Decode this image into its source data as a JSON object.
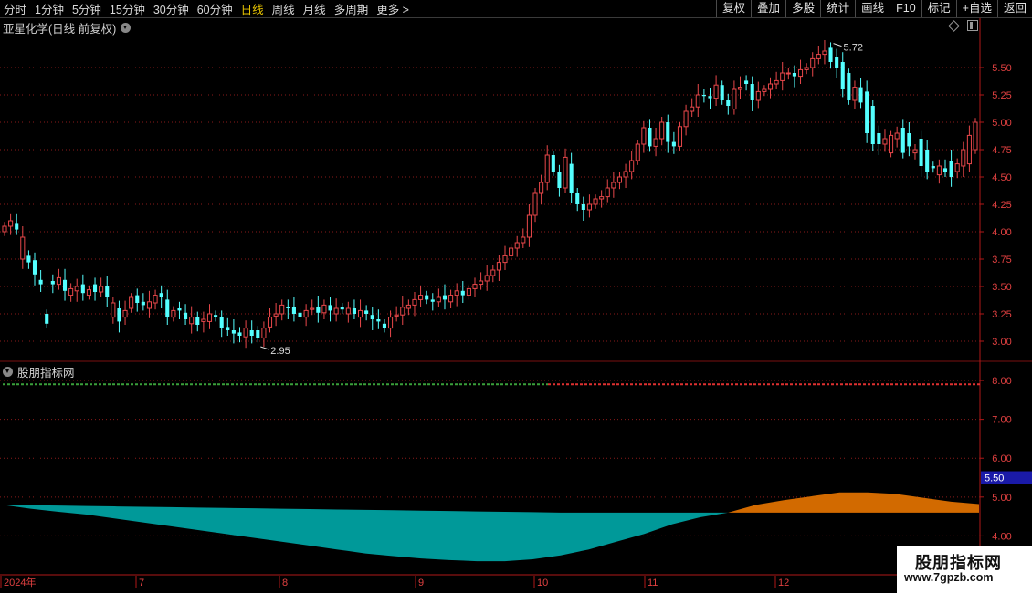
{
  "toolbar": {
    "periods": [
      "分时",
      "1分钟",
      "5分钟",
      "15分钟",
      "30分钟",
      "60分钟",
      "日线",
      "周线",
      "月线",
      "多周期",
      "更多 >"
    ],
    "active_period": "日线",
    "actions": [
      "复权",
      "叠加",
      "多股",
      "统计",
      "画线",
      "F10",
      "标记",
      "+自选",
      "返回"
    ]
  },
  "main_title": "亚星化学(日线 前复权)",
  "indicator_title": "股朋指标网",
  "watermark": {
    "line1": "股朋指标网",
    "line2": "www.7gpzb.com"
  },
  "colors": {
    "up": "#e8474a",
    "down": "#54ffff",
    "grid": "#8a1a1a",
    "axis": "#b01818",
    "teal": "#009999",
    "orange": "#d26a00"
  },
  "chart_data": [
    {
      "type": "candlestick",
      "title": "亚星化学(日线 前复权)",
      "y_ticks": [
        5.5,
        5.25,
        5.0,
        4.75,
        4.5,
        4.25,
        4.0,
        3.75,
        3.5,
        3.25,
        3.0
      ],
      "ylim": [
        2.85,
        5.8
      ],
      "annotations": [
        {
          "label": "5.72",
          "value": 5.72
        },
        {
          "label": "2.95",
          "value": 2.95
        }
      ],
      "date_labels": [
        "2024年",
        "7",
        "8",
        "9",
        "10",
        "11",
        "12"
      ],
      "closes": [
        4.05,
        4.1,
        4.02,
        3.95,
        3.72,
        3.61,
        3.52,
        3.16,
        3.52,
        3.58,
        3.46,
        3.48,
        3.5,
        3.44,
        3.47,
        3.45,
        3.5,
        3.4,
        3.35,
        3.18,
        3.28,
        3.4,
        3.35,
        3.33,
        3.36,
        3.42,
        3.4,
        3.22,
        3.28,
        3.28,
        3.2,
        3.22,
        3.15,
        3.2,
        3.25,
        3.22,
        3.12,
        3.1,
        3.07,
        3.05,
        3.12,
        3.05,
        3.03,
        3.12,
        3.22,
        3.25,
        3.33,
        3.3,
        3.25,
        3.22,
        3.28,
        3.3,
        3.26,
        3.33,
        3.28,
        3.3,
        3.29,
        3.3,
        3.25,
        3.28,
        3.25,
        3.2,
        3.18,
        3.12,
        3.22,
        3.24,
        3.31,
        3.33,
        3.38,
        3.42,
        3.38,
        3.36,
        3.4,
        3.38,
        3.42,
        3.46,
        3.42,
        3.48,
        3.52,
        3.55,
        3.6,
        3.65,
        3.72,
        3.78,
        3.85,
        3.9,
        3.95,
        4.15,
        4.35,
        4.45,
        4.7,
        4.55,
        4.4,
        4.68,
        4.35,
        4.25,
        4.2,
        4.25,
        4.3,
        4.32,
        4.4,
        4.45,
        4.5,
        4.55,
        4.65,
        4.8,
        4.95,
        4.78,
        4.85,
        5.0,
        4.82,
        4.78,
        4.96,
        5.1,
        5.14,
        5.25,
        5.24,
        5.22,
        5.34,
        5.2,
        5.15,
        5.3,
        5.32,
        5.35,
        5.2,
        5.28,
        5.3,
        5.35,
        5.38,
        5.45,
        5.45,
        5.42,
        5.48,
        5.5,
        5.58,
        5.62,
        5.65,
        5.55,
        5.5,
        5.3,
        5.2,
        5.32,
        5.18,
        4.9,
        4.8,
        4.8,
        4.85,
        4.88,
        4.9,
        4.72,
        4.78,
        4.75,
        4.6,
        4.55,
        4.58,
        4.6,
        4.55,
        4.5,
        4.62,
        4.75,
        4.88,
        5.0
      ],
      "opens": [
        4.0,
        4.05,
        4.08,
        3.75,
        3.78,
        3.74,
        3.56,
        3.25,
        3.55,
        3.52,
        3.56,
        3.42,
        3.46,
        3.52,
        3.42,
        3.52,
        3.45,
        3.5,
        3.22,
        3.3,
        3.22,
        3.3,
        3.42,
        3.36,
        3.3,
        3.35,
        3.44,
        3.38,
        3.22,
        3.3,
        3.26,
        3.16,
        3.22,
        3.18,
        3.18,
        3.24,
        3.22,
        3.13,
        3.1,
        3.08,
        3.04,
        3.1,
        3.1,
        3.03,
        3.13,
        3.23,
        3.25,
        3.31,
        3.31,
        3.26,
        3.22,
        3.29,
        3.31,
        3.26,
        3.33,
        3.25,
        3.31,
        3.25,
        3.3,
        3.22,
        3.28,
        3.24,
        3.2,
        3.16,
        3.12,
        3.23,
        3.24,
        3.3,
        3.33,
        3.38,
        3.42,
        3.38,
        3.36,
        3.42,
        3.36,
        3.42,
        3.46,
        3.42,
        3.48,
        3.52,
        3.55,
        3.6,
        3.65,
        3.72,
        3.78,
        3.85,
        3.9,
        3.95,
        4.15,
        4.35,
        4.45,
        4.7,
        4.55,
        4.4,
        4.62,
        4.35,
        4.25,
        4.2,
        4.25,
        4.3,
        4.32,
        4.4,
        4.45,
        4.5,
        4.55,
        4.65,
        4.8,
        4.95,
        4.78,
        4.85,
        5.0,
        4.82,
        4.78,
        4.96,
        5.1,
        5.14,
        5.25,
        5.24,
        5.22,
        5.34,
        5.2,
        5.12,
        5.3,
        5.38,
        5.35,
        5.2,
        5.28,
        5.3,
        5.35,
        5.38,
        5.45,
        5.45,
        5.42,
        5.48,
        5.5,
        5.58,
        5.62,
        5.68,
        5.6,
        5.55,
        5.45,
        5.2,
        5.32,
        5.28,
        5.15,
        4.9,
        4.8,
        4.72,
        4.85,
        4.95,
        4.9,
        4.72,
        4.85,
        4.75,
        4.6,
        4.52,
        4.58,
        4.65,
        4.55,
        4.6,
        4.62,
        4.75,
        4.88
      ]
    },
    {
      "type": "area",
      "title": "股朋指标网",
      "y_ticks": [
        8.0,
        7.0,
        6.0,
        5.0,
        4.0
      ],
      "ylim": [
        3.0,
        8.4
      ],
      "highlight_value": 5.5,
      "reference_value": 7.9,
      "base_value": 4.6,
      "series": [
        {
          "values": [
            4.8,
            4.7,
            4.62,
            4.55,
            4.45,
            4.35,
            4.25,
            4.15,
            4.05,
            3.95,
            3.85,
            3.75,
            3.65,
            3.55,
            3.48,
            3.42,
            3.38,
            3.35,
            3.35,
            3.4,
            3.5,
            3.65,
            3.85,
            4.05,
            4.3,
            4.48,
            4.6,
            4.8,
            4.92,
            5.02,
            5.12,
            5.12,
            5.08,
            4.98,
            4.88,
            4.82
          ]
        }
      ],
      "top_values": [
        4.8,
        4.79,
        4.78,
        4.77,
        4.76,
        4.75,
        4.74,
        4.73,
        4.72,
        4.71,
        4.7,
        4.69,
        4.68,
        4.67,
        4.66,
        4.65,
        4.64,
        4.63,
        4.62,
        4.61,
        4.6,
        4.6,
        4.6,
        4.6,
        4.6,
        4.6,
        4.6,
        4.8,
        4.92,
        5.02,
        5.12,
        5.12,
        5.08,
        4.98,
        4.88,
        4.82
      ]
    }
  ]
}
